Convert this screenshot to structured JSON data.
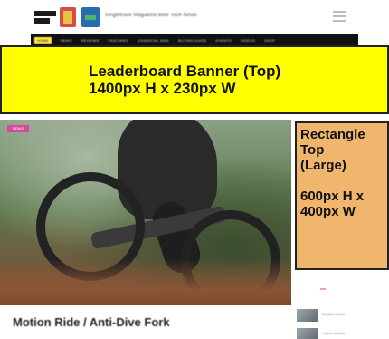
{
  "header": {
    "site_name": "Singletrack Magazine Bike Tech News",
    "logos": [
      "magazine-logo",
      "brand-logo-red",
      "brand-logo-blue"
    ],
    "menu_icon": "hamburger-menu-icon"
  },
  "nav": {
    "items": [
      "HOME",
      "NEWS",
      "REVIEWS",
      "FEATURES",
      "ESSENTIAL BIKE",
      "BUYING GUIDE",
      "EVENTS",
      "VIDEOS",
      "SHOP"
    ],
    "active_index": 0
  },
  "ads": {
    "leaderboard": {
      "line1": "Leaderboard Banner (Top)",
      "line2": "1400px H x 230px W",
      "color": "#ffff00"
    },
    "rectangle": {
      "line1": "Rectangle",
      "line2": "Top",
      "line3": "(Large)",
      "line4": "600px H x",
      "line5": "400px W",
      "color": "#f0b66e"
    }
  },
  "article": {
    "badge": "NEWS",
    "title": "Motion Ride / Anti-Dive Fork"
  },
  "sidebar": {
    "items": [
      {
        "text": "Related article"
      },
      {
        "text": "Latest reviews"
      }
    ]
  }
}
